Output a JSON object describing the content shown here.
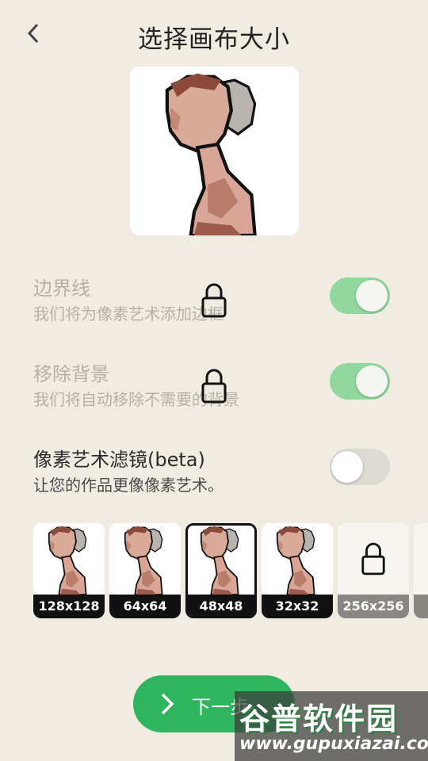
{
  "header": {
    "title": "选择画布大小",
    "back_icon": "chevron-left-icon"
  },
  "options": [
    {
      "label": "边界线",
      "sub": "我们将为像素艺术添加边框",
      "enabled": true,
      "locked": true
    },
    {
      "label": "移除背景",
      "sub": "我们将自动移除不需要的背景",
      "enabled": true,
      "locked": true
    },
    {
      "label": "像素艺术滤镜(beta)",
      "sub": "让您的作品更像像素艺术。",
      "enabled": false,
      "locked": false
    }
  ],
  "sizes": [
    {
      "label": "128x128",
      "selected": false,
      "locked": false
    },
    {
      "label": "64x64",
      "selected": false,
      "locked": false
    },
    {
      "label": "48x48",
      "selected": true,
      "locked": false
    },
    {
      "label": "32x32",
      "selected": false,
      "locked": false
    },
    {
      "label": "256x256",
      "selected": false,
      "locked": true
    }
  ],
  "next_button": {
    "label": "下一步"
  },
  "watermark": {
    "main": "谷普软件园",
    "url": "www.gupuxiazai.com"
  },
  "colors": {
    "accent": "#2fb45f",
    "toggle_on": "#92d79d",
    "background": "#f1ece2"
  }
}
